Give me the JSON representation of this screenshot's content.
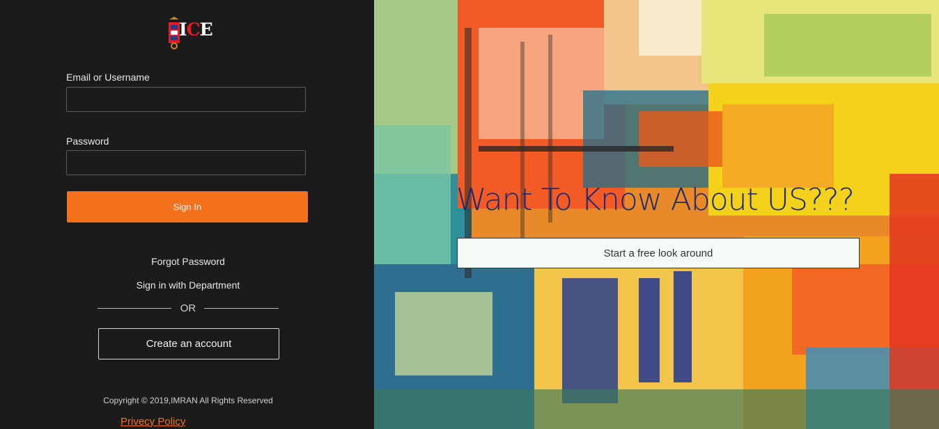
{
  "logo": {
    "text_dark": "I",
    "text_red": "C",
    "text_light": "E"
  },
  "login": {
    "email_label": "Email or Username",
    "email_value": "",
    "password_label": "Password",
    "password_value": "",
    "signin_label": "Sign In",
    "forgot_label": "Forgot Password",
    "department_label": "Sign in with Department",
    "or_label": "OR",
    "create_label": "Create an account"
  },
  "footer": {
    "copyright": "Copyright © 2019,IMRAN All Rights Reserved",
    "privacy_label": "Privecy Policy"
  },
  "hero": {
    "title": "Want To Know About US???",
    "cta_label": "Start a free look around"
  },
  "colors": {
    "accent": "#f4711c",
    "panel_bg": "#1b1b1b",
    "hero_title": "#1f2a6e"
  },
  "icons": [
    "logo-emblem-icon",
    "abstract-painting-background"
  ]
}
